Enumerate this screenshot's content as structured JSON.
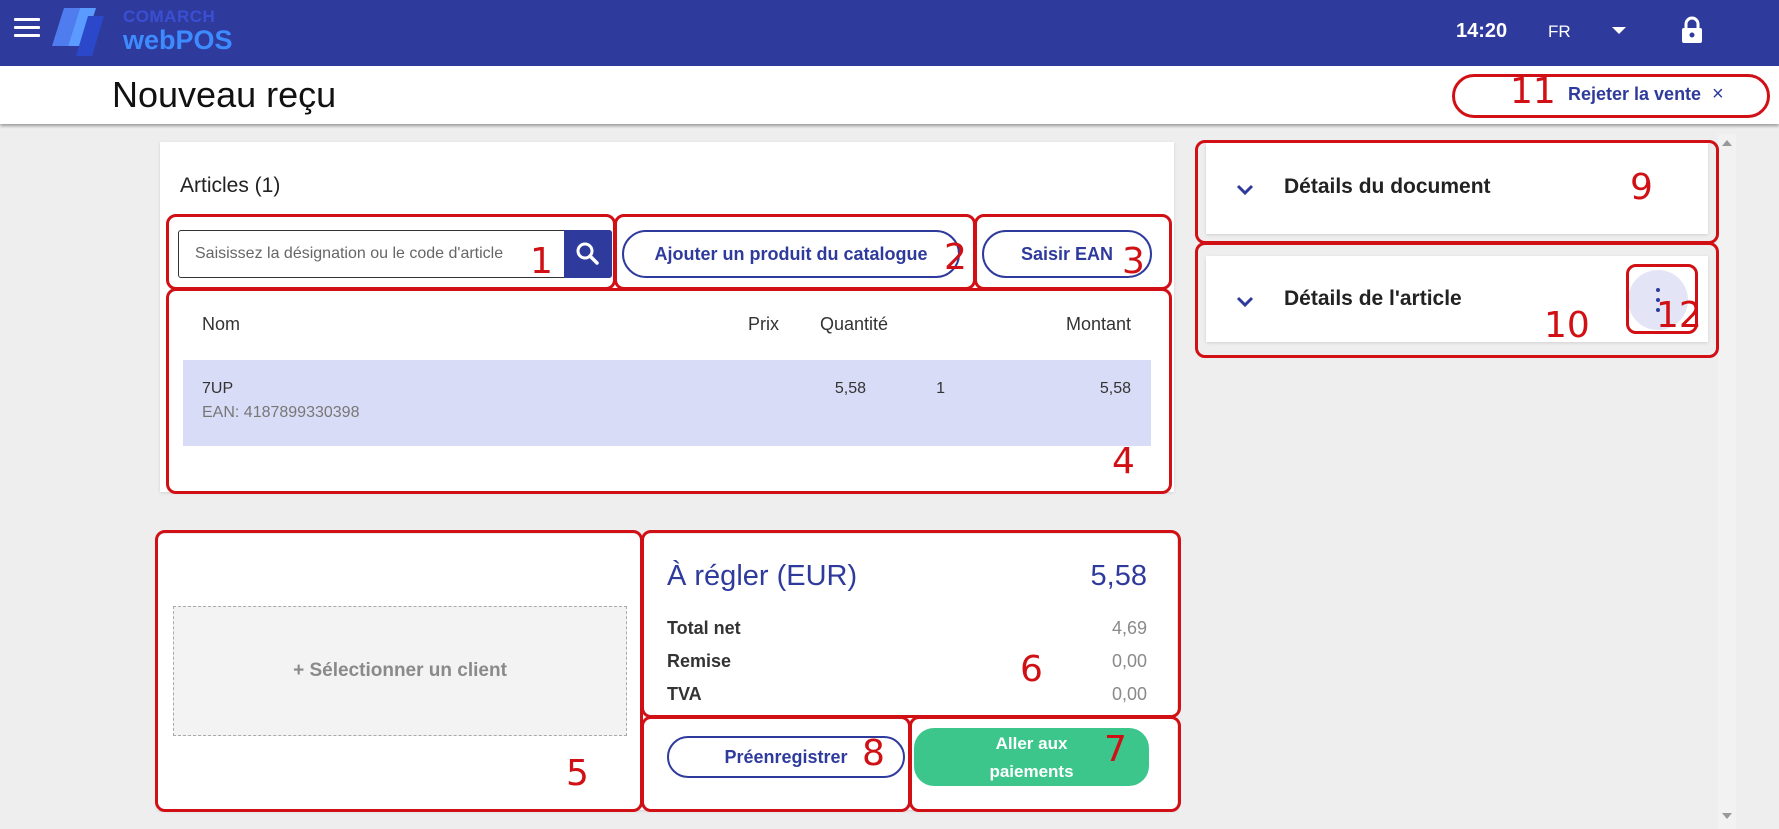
{
  "header": {
    "brand": "COMARCH",
    "product": "webPOS",
    "time": "14:20",
    "language": "FR"
  },
  "title_bar": {
    "title": "Nouveau reçu",
    "reject_label": "Rejeter la vente",
    "reject_close": "×"
  },
  "articles": {
    "title": "Articles (1)",
    "search_placeholder": "Saisissez la désignation ou le code d'article",
    "catalog_button": "Ajouter un produit du catalogue",
    "ean_button": "Saisir EAN",
    "columns": {
      "name": "Nom",
      "price": "Prix",
      "quantity": "Quantité",
      "amount": "Montant"
    },
    "rows": [
      {
        "name": "7UP",
        "ean": "EAN: 4187899330398",
        "price": "5,58",
        "quantity": "1",
        "amount": "5,58"
      }
    ]
  },
  "client": {
    "select_label": "+ Sélectionner un client"
  },
  "payment": {
    "title": "À régler (EUR)",
    "total": "5,58",
    "lines": [
      {
        "label": "Total net",
        "value": "4,69"
      },
      {
        "label": "Remise",
        "value": "0,00"
      },
      {
        "label": "TVA",
        "value": "0,00"
      }
    ],
    "prereg_button": "Préenregistrer",
    "pay_button_line1": "Aller aux",
    "pay_button_line2": "paiements"
  },
  "side_panels": {
    "document_details": "Détails du document",
    "article_details": "Détails de l'article"
  },
  "annotations": [
    "1",
    "2",
    "3",
    "4",
    "5",
    "6",
    "7",
    "8",
    "9",
    "10",
    "11",
    "12"
  ],
  "colors": {
    "primary": "#2f3b9c",
    "pay_button": "#3cc68b",
    "selected_row": "#d9dcf6",
    "annotation": "#d01015"
  }
}
